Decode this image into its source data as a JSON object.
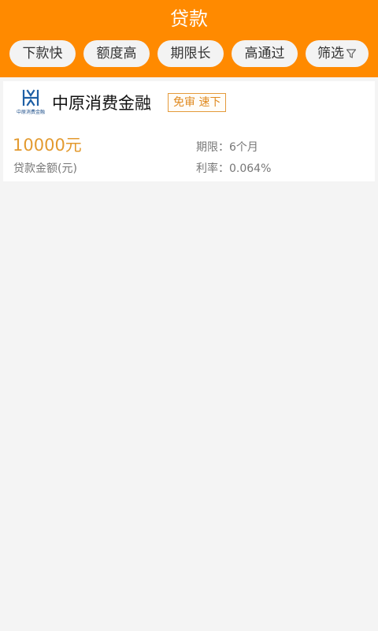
{
  "header": {
    "title": "贷款",
    "background_color": "#ff8a00"
  },
  "filters": {
    "items": [
      {
        "label": "下款快"
      },
      {
        "label": "额度高"
      },
      {
        "label": "期限长"
      },
      {
        "label": "高通过"
      },
      {
        "label": "筛选",
        "icon": "filter-icon"
      }
    ]
  },
  "loan_card": {
    "lender_name": "中原消费金融",
    "logo_text": "中原消费金融",
    "tag": "免审 速下",
    "amount": "10000元",
    "amount_label": "贷款金额(元)",
    "term": "期限：6个月",
    "rate": "利率：0.064%",
    "accent_color": "#e39a2f"
  }
}
